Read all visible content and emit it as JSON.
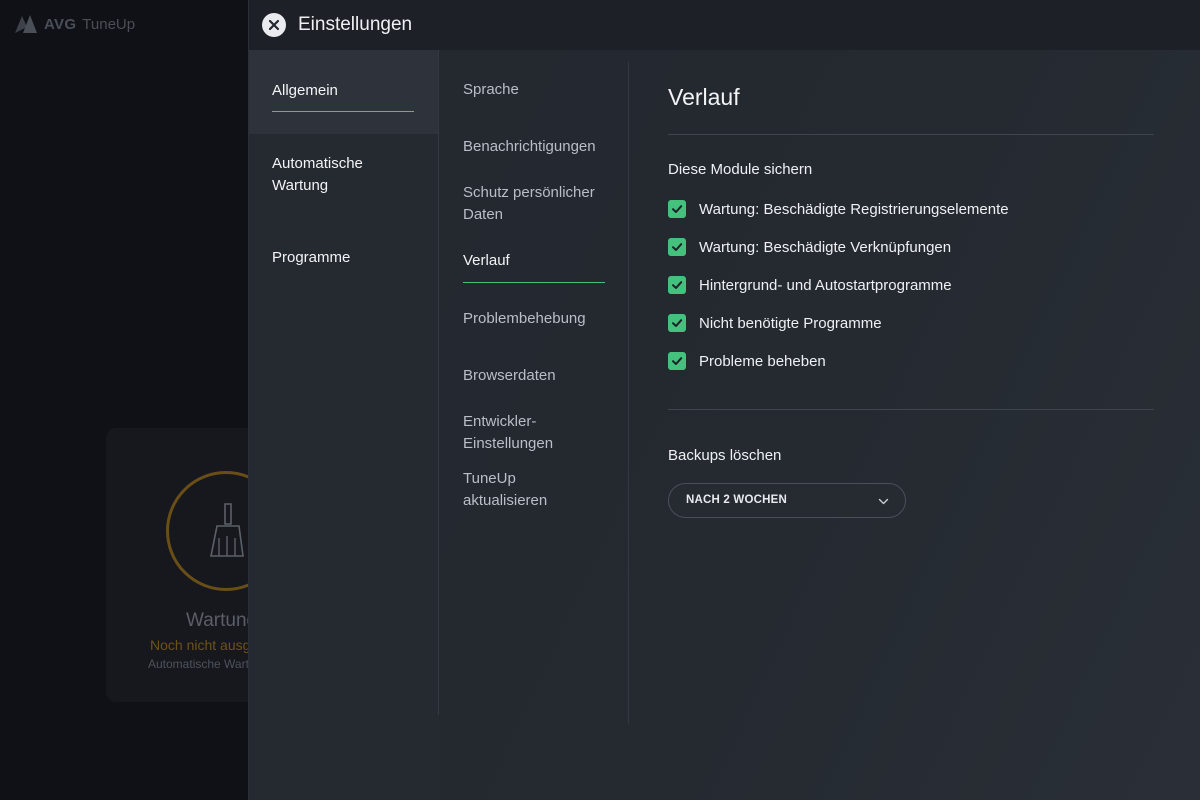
{
  "background_app": {
    "logo_brand": "AVG",
    "logo_product": "TuneUp",
    "card_title": "Wartung",
    "card_status": "Noch nicht ausgeführt",
    "card_subtitle": "Automatische Wartung",
    "status_color": "#6e5219"
  },
  "settings": {
    "title": "Einstellungen",
    "accent_color": "#43c17d",
    "nav_primary": [
      {
        "label": "Allgemein",
        "active": true
      },
      {
        "label": "Automatische Wartung",
        "active": false
      },
      {
        "label": "Programme",
        "active": false
      }
    ],
    "nav_secondary": [
      {
        "label": "Sprache",
        "active": false
      },
      {
        "label": "Benachrichtigungen",
        "active": false
      },
      {
        "label": "Schutz persönlicher Daten",
        "active": false
      },
      {
        "label": "Verlauf",
        "active": true
      },
      {
        "label": "Problembehebung",
        "active": false
      },
      {
        "label": "Browserdaten",
        "active": false
      },
      {
        "label": "Entwickler-Einstellungen",
        "active": false
      },
      {
        "label": "TuneUp aktualisieren",
        "active": false
      }
    ],
    "content": {
      "title": "Verlauf",
      "modules_label": "Diese Module sichern",
      "modules": [
        {
          "label": "Wartung: Beschädigte Registrierungselemente",
          "checked": true
        },
        {
          "label": "Wartung: Beschädigte Verknüpfungen",
          "checked": true
        },
        {
          "label": "Hintergrund- und Autostartprogramme",
          "checked": true
        },
        {
          "label": "Nicht benötigte Programme",
          "checked": true
        },
        {
          "label": "Probleme beheben",
          "checked": true
        }
      ],
      "backups_label": "Backups löschen",
      "backups_select_value": "NACH 2 WOCHEN"
    }
  }
}
